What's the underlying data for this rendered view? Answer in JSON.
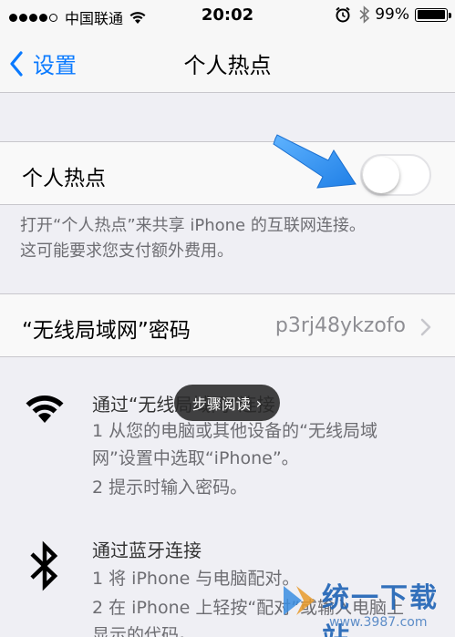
{
  "status_bar": {
    "carrier": "中国联通",
    "time": "20:02",
    "battery": "99%",
    "battery_level": 0.99,
    "signal_bars_filled": 4,
    "signal_bars_total": 5
  },
  "nav": {
    "back_label": "设置",
    "title": "个人热点"
  },
  "hotspot": {
    "label": "个人热点",
    "enabled": false,
    "footer_line1": "打开“个人热点”来共享 iPhone 的互联网连接。",
    "footer_line2": "这可能要求您支付额外费用。"
  },
  "password": {
    "label": "“无线局域网”密码",
    "value": "p3rj48ykzofo"
  },
  "instructions": {
    "wifi": {
      "title": "通过“无线局域网”连接",
      "step1_line1": "1 从您的电脑或其他设备的“无线局域",
      "step1_line2": "网”设置中选取“iPhone”。",
      "step2": "2 提示时输入密码。"
    },
    "bluetooth": {
      "title": "通过蓝牙连接",
      "step1": "1 将 iPhone 与电脑配对。",
      "step2_line1": "2 在 iPhone 上轻按“配对”或输入电脑上",
      "step2_line2": "显示的代码。"
    }
  },
  "overlay": {
    "step_read": "步骤阅读",
    "arrow_color": "#2a8cf0"
  },
  "watermark": {
    "name": "统一下载站",
    "url": "www.3987.com"
  },
  "colors": {
    "accent": "#0a7aff",
    "background": "#efeff4"
  }
}
